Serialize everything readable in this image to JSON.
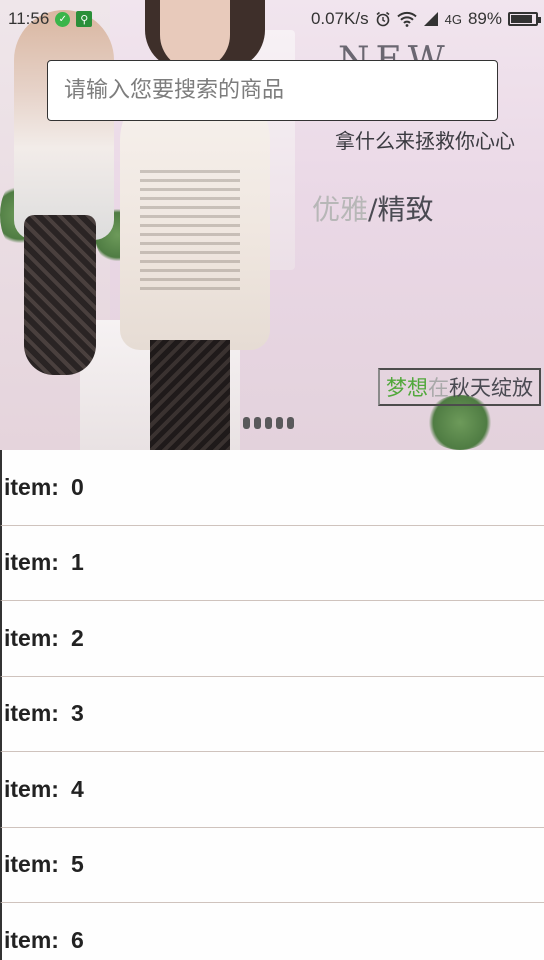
{
  "status_bar": {
    "time": "11:56",
    "speed": "0.07K/s",
    "network": "4G",
    "battery": "89%",
    "battery_level": 0.89,
    "icons": [
      "app-circle-icon",
      "app-square-icon",
      "alarm-icon",
      "wifi-icon",
      "signal-icon",
      "battery-icon"
    ]
  },
  "search": {
    "placeholder": "请输入您要搜索的商品",
    "value": ""
  },
  "banner": {
    "title": "NEW",
    "subtitle": "拿什么来拯救你心心",
    "elegant_light": "优雅",
    "elegant_sep": "/",
    "elegant_dark": "精致",
    "dream_green": "梦想",
    "dream_light": "在",
    "dream_dark": "秋天绽放",
    "page_count": 5,
    "active_page": 0
  },
  "list": {
    "items": [
      {
        "label": "item:",
        "index": "0"
      },
      {
        "label": "item:",
        "index": "1"
      },
      {
        "label": "item:",
        "index": "2"
      },
      {
        "label": "item:",
        "index": "3"
      },
      {
        "label": "item:",
        "index": "4"
      },
      {
        "label": "item:",
        "index": "5"
      },
      {
        "label": "item:",
        "index": "6"
      }
    ]
  }
}
